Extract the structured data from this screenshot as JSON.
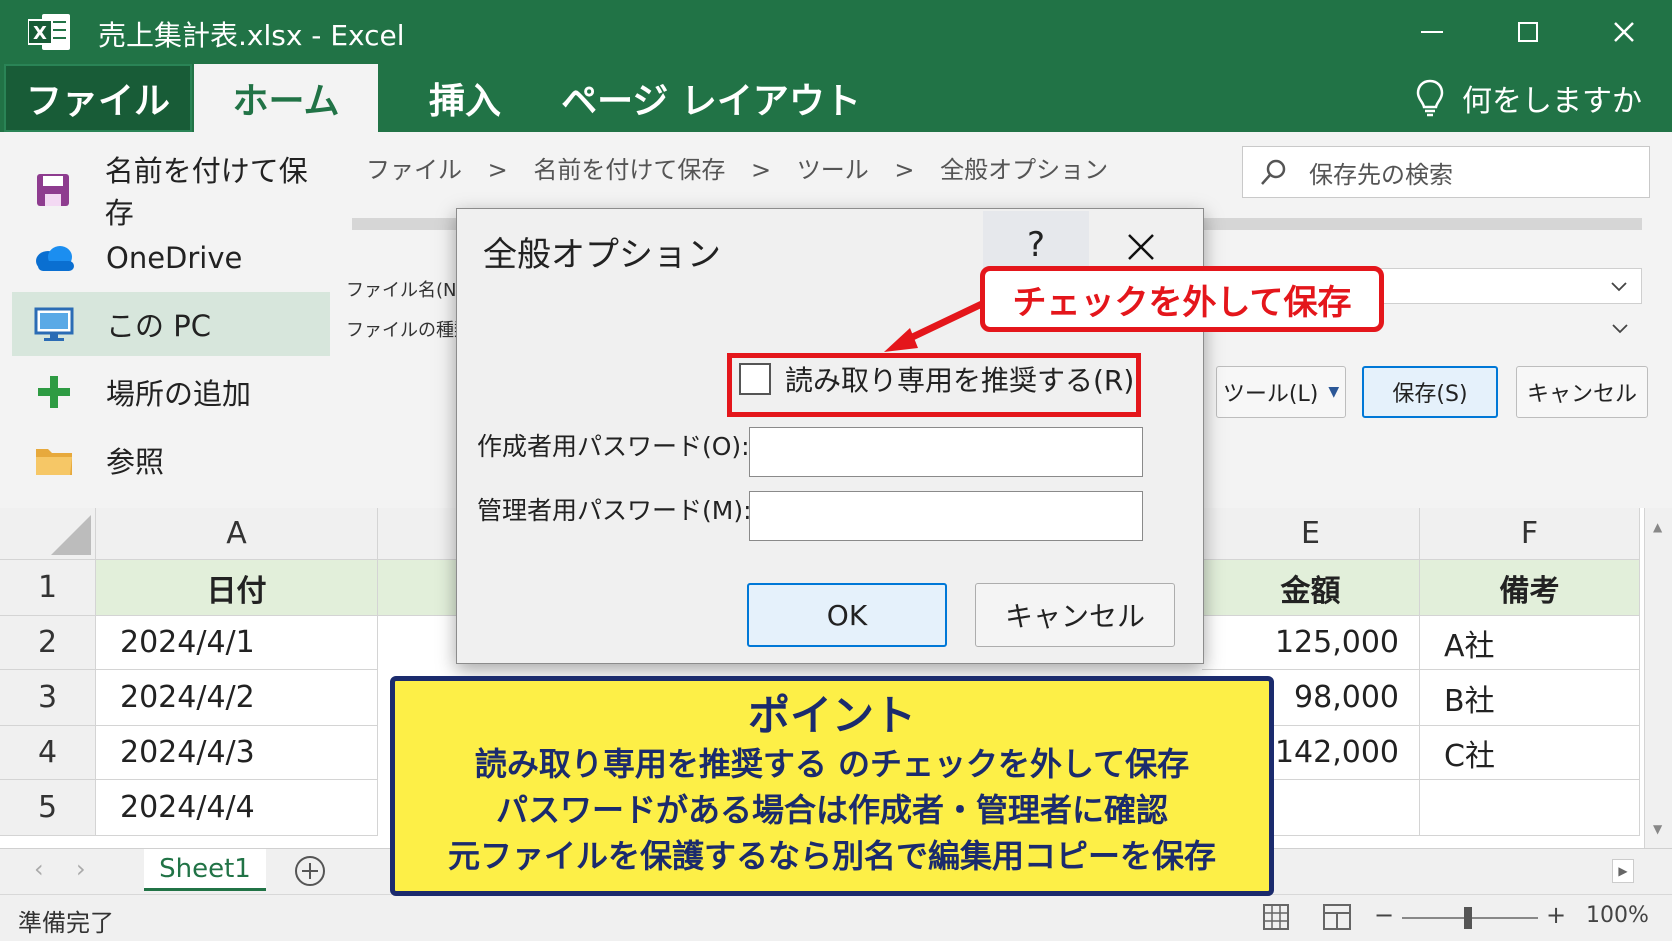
{
  "window": {
    "title": "売上集計表.xlsx  -  Excel",
    "minimize_icon": "minimize-icon",
    "maximize_icon": "maximize-icon",
    "close_icon": "close-icon"
  },
  "ribbon": {
    "tabs": [
      {
        "label": "ファイル"
      },
      {
        "label": "ホーム"
      },
      {
        "label": "挿入"
      },
      {
        "label": "ページ レイアウト"
      }
    ],
    "tell_me": "何をしますか"
  },
  "backstage": {
    "nav": [
      {
        "label": "名前を付けて保存",
        "icon": "save-icon"
      },
      {
        "label": "OneDrive",
        "icon": "cloud-icon"
      },
      {
        "label": "この PC",
        "icon": "pc-icon"
      },
      {
        "label": "場所の追加",
        "icon": "plus-icon"
      },
      {
        "label": "参照",
        "icon": "folder-icon"
      }
    ],
    "breadcrumb": [
      "ファイル",
      ">",
      "名前を付けて保存",
      ">",
      "ツール",
      ">",
      "全般オプション"
    ],
    "search_placeholder": "保存先の検索",
    "filename_label": "ファイル名(N):",
    "filetype_label": "ファイルの種類(",
    "tools_button": "ツール(L)",
    "save_button": "保存(S)",
    "cancel_button": "キャンセル"
  },
  "sheet": {
    "columns": [
      "A",
      "E",
      "F"
    ],
    "rows": [
      {
        "num": "1",
        "a": "日付",
        "e": "金額",
        "f": "備考"
      },
      {
        "num": "2",
        "a": "2024/4/1",
        "e": "125,000",
        "f": "A社"
      },
      {
        "num": "3",
        "a": "2024/4/2",
        "e": "98,000",
        "f": "B社"
      },
      {
        "num": "4",
        "a": "2024/4/3",
        "e": "142,000",
        "f": "C社"
      },
      {
        "num": "5",
        "a": "2024/4/4",
        "e": "",
        "f": ""
      }
    ],
    "tab_name": "Sheet1",
    "status": "準備完了",
    "zoom": "100%"
  },
  "dialog": {
    "title": "全般オプション",
    "help": "?",
    "readonly_label": "読み取り専用を推奨する(R)",
    "readonly_checked": false,
    "author_pw_label": "作成者用パスワード(O):",
    "admin_pw_label": "管理者用パスワード(M):",
    "ok": "OK",
    "cancel": "キャンセル"
  },
  "callout": "チェックを外して保存",
  "point": {
    "title": "ポイント",
    "lines": [
      "読み取り専用を推奨する のチェックを外して保存",
      "パスワードがある場合は作成者・管理者に確認",
      "元ファイルを保護するなら別名で編集用コピーを保存"
    ]
  },
  "colors": {
    "excel_green": "#217346",
    "alert_red": "#e4161b",
    "point_yellow": "#fdef47",
    "point_navy": "#1b2b6d"
  }
}
